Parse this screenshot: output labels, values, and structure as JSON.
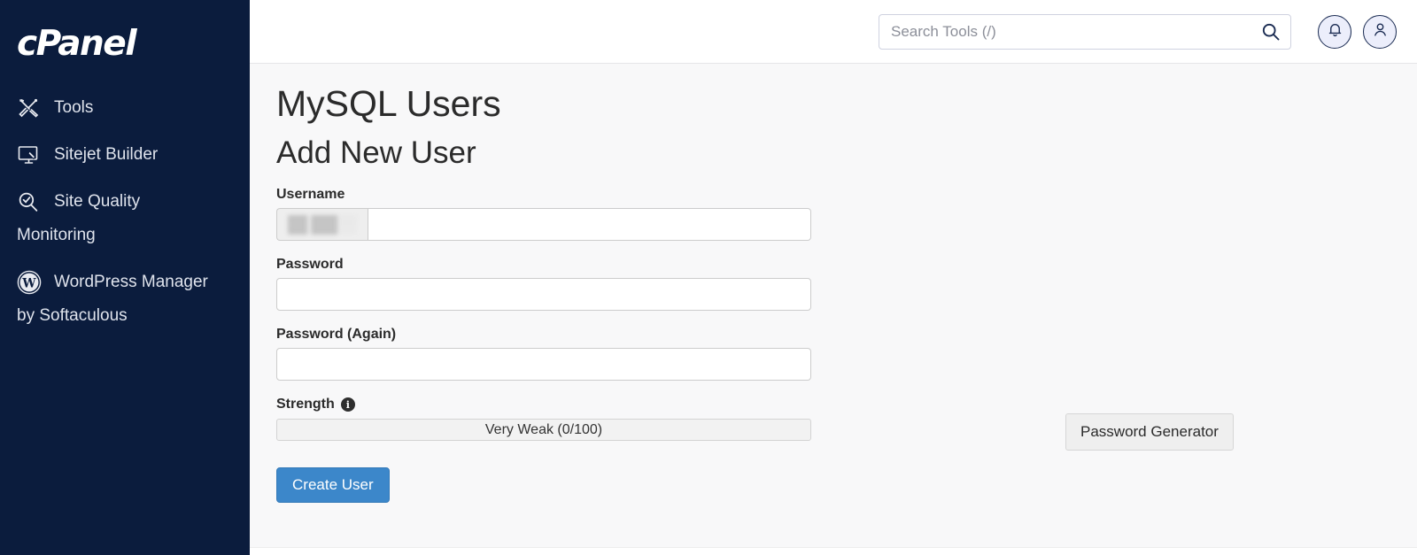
{
  "brand": {
    "logo_text": "cPanel",
    "sidebar_bg": "#0b1c3d"
  },
  "sidebar": {
    "items": [
      {
        "label": "Tools",
        "icon": "tools-icon",
        "wrap": ""
      },
      {
        "label": "Sitejet Builder",
        "icon": "sitejet-builder-icon",
        "wrap": ""
      },
      {
        "label": "Site Quality",
        "icon": "site-quality-icon",
        "wrap": "Monitoring"
      },
      {
        "label": "WordPress Manager",
        "icon": "wordpress-icon",
        "wrap": "by Softaculous"
      }
    ]
  },
  "topbar": {
    "search_placeholder": "Search Tools (/)",
    "search_value": "",
    "search_icon": "search-icon",
    "notifications_icon": "bell-icon",
    "account_icon": "user-icon"
  },
  "main": {
    "page_title": "MySQL Users",
    "section_title": "Add New User",
    "fields": {
      "username_label": "Username",
      "username_prefix": "",
      "username_value": "",
      "password_label": "Password",
      "password_value": "",
      "password_again_label": "Password (Again)",
      "password_again_value": "",
      "strength_label": "Strength",
      "strength_info_icon": "info-icon",
      "strength_text": "Very Weak (0/100)",
      "strength_score": 0,
      "strength_max": 100
    },
    "buttons": {
      "create_user": "Create User",
      "password_generator": "Password Generator",
      "primary_color": "#3c87ca"
    }
  }
}
